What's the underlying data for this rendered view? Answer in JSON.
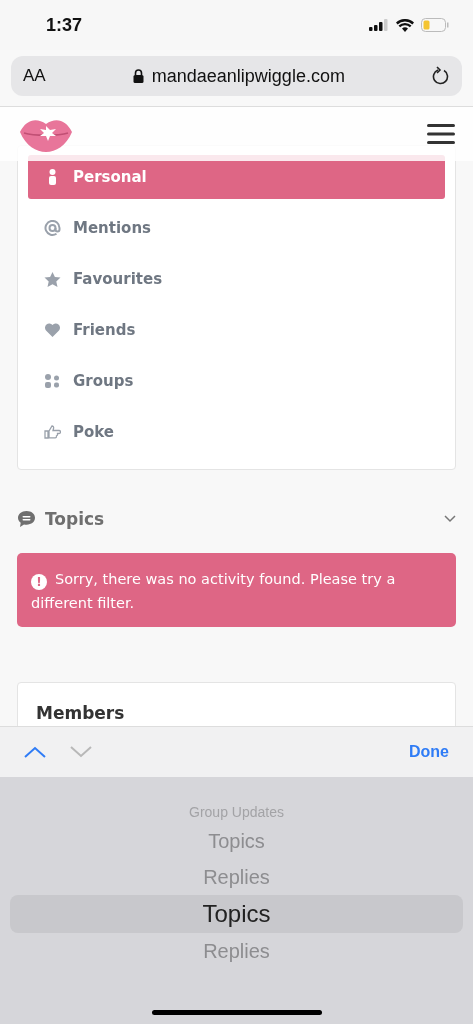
{
  "status_bar": {
    "time": "1:37"
  },
  "browser": {
    "text_size": "AA",
    "url": "mandaeanlipwiggle.com"
  },
  "nav": [
    {
      "label": "Personal",
      "kind": "person",
      "selected": true
    },
    {
      "label": "Mentions",
      "kind": "at",
      "selected": false
    },
    {
      "label": "Favourites",
      "kind": "star",
      "selected": false
    },
    {
      "label": "Friends",
      "kind": "heart",
      "selected": false
    },
    {
      "label": "Groups",
      "kind": "groups",
      "selected": false
    },
    {
      "label": "Poke",
      "kind": "poke",
      "selected": false
    }
  ],
  "section": {
    "title": "Topics",
    "expanded": false
  },
  "alert": {
    "icon": "!",
    "text": "Sorry, there was no activity found. Please try a different filter."
  },
  "members": {
    "title": "Members"
  },
  "toolbar": {
    "done": "Done"
  },
  "picker": [
    {
      "label": "Group Updates",
      "selected": false
    },
    {
      "label": "Topics",
      "selected": false
    },
    {
      "label": "Replies",
      "selected": false
    },
    {
      "label": "Topics",
      "selected": true
    },
    {
      "label": "Replies",
      "selected": false
    }
  ]
}
